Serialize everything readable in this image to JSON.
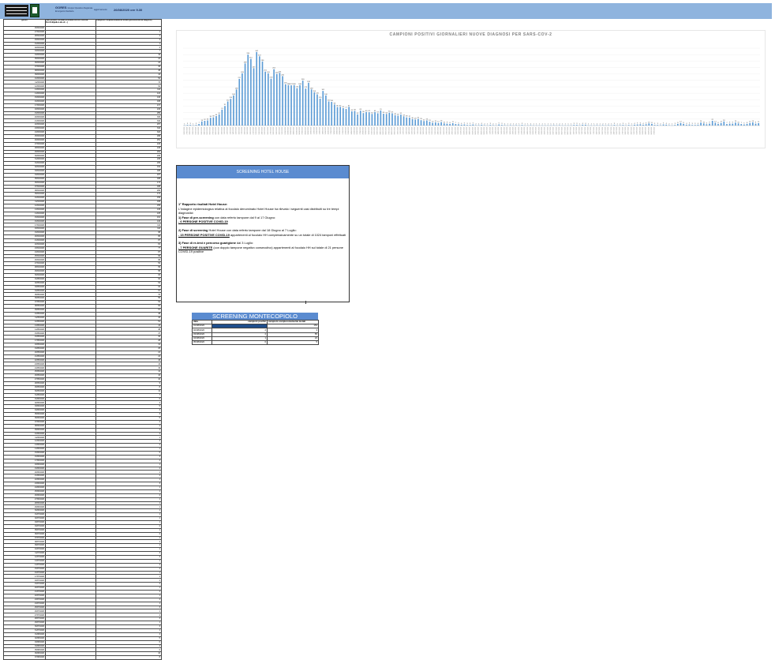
{
  "header": {
    "org": "GORES",
    "org_suffix": "Gruppo Operativo Regionale",
    "org_sub": "Emergenza Sanitaria",
    "updated_label": "aggiornamento",
    "updated_value": "26/08/2020 ore 9.30",
    "logo_icon": "regione-marche-logo",
    "emblem_icon": "gores-emblem"
  },
  "cases_table": {
    "headers": [
      "giorno",
      "Casi positivi Focolaio (Comune HOTEL HOUSE Port.S.Elpidio-Lido di ...)",
      "Campioni complessivamente testati (persona-nuove diagnosi)"
    ],
    "rows": [
      [
        "26/02/2020",
        "",
        ""
      ],
      [
        "27/02/2020",
        "",
        "1"
      ],
      [
        "28/02/2020",
        "",
        "3"
      ],
      [
        "29/02/2020",
        "",
        "3"
      ],
      [
        "01/03/2020",
        "",
        "1"
      ],
      [
        "02/03/2020",
        "",
        "3"
      ],
      [
        "03/03/2020",
        "",
        "7"
      ],
      [
        "04/03/2020",
        "",
        "19"
      ],
      [
        "05/03/2020",
        "",
        "22"
      ],
      [
        "06/03/2020",
        "",
        "24"
      ],
      [
        "07/03/2020",
        "",
        "36"
      ],
      [
        "08/03/2020",
        "",
        "38"
      ],
      [
        "09/03/2020",
        "",
        "44"
      ],
      [
        "10/03/2020",
        "",
        "52"
      ],
      [
        "11/03/2020",
        "",
        "74"
      ],
      [
        "12/03/2020",
        "",
        "91"
      ],
      [
        "13/03/2020",
        "",
        "112"
      ],
      [
        "14/03/2020",
        "",
        "124"
      ],
      [
        "15/03/2020",
        "",
        "140"
      ],
      [
        "16/03/2020",
        "",
        "168"
      ],
      [
        "17/03/2020",
        "",
        "217"
      ],
      [
        "18/03/2020",
        "",
        "243"
      ],
      [
        "19/03/2020",
        "",
        "289"
      ],
      [
        "20/03/2020",
        "",
        "330"
      ],
      [
        "21/03/2020",
        "",
        "310"
      ],
      [
        "22/03/2020",
        "",
        "267"
      ],
      [
        "23/03/2020",
        "",
        "342"
      ],
      [
        "24/03/2020",
        "",
        "322"
      ],
      [
        "25/03/2020",
        "",
        "298"
      ],
      [
        "26/03/2020",
        "",
        "251"
      ],
      [
        "27/03/2020",
        "",
        "243"
      ],
      [
        "28/03/2020",
        "",
        "218"
      ],
      [
        "29/03/2020",
        "",
        "262"
      ],
      [
        "30/03/2020",
        "",
        "240"
      ],
      [
        "31/03/2020",
        "",
        "245"
      ],
      [
        "01/04/2020",
        "",
        "230"
      ],
      [
        "02/04/2020",
        "",
        "192"
      ],
      [
        "03/04/2020",
        "",
        "188"
      ],
      [
        "04/04/2020",
        "",
        "187"
      ],
      [
        "05/04/2020",
        "",
        "188"
      ],
      [
        "06/04/2020",
        "",
        "174"
      ],
      [
        "07/04/2020",
        "",
        "188"
      ],
      [
        "08/04/2020",
        "",
        "209"
      ],
      [
        "09/04/2020",
        "",
        "172"
      ],
      [
        "10/04/2020",
        "",
        "199"
      ],
      [
        "11/04/2020",
        "",
        "168"
      ],
      [
        "12/04/2020",
        "",
        "155"
      ],
      [
        "13/04/2020",
        "",
        "145"
      ],
      [
        "14/04/2020",
        "",
        "125"
      ],
      [
        "15/04/2020",
        "",
        "161"
      ],
      [
        "16/04/2020",
        "",
        "140"
      ],
      [
        "17/04/2020",
        "",
        "112"
      ],
      [
        "18/04/2020",
        "",
        "110"
      ],
      [
        "19/04/2020",
        "",
        "98"
      ],
      [
        "20/04/2020",
        "",
        "86"
      ],
      [
        "21/04/2020",
        "",
        "87"
      ],
      [
        "22/04/2020",
        "",
        "81"
      ],
      [
        "23/04/2020",
        "",
        "77"
      ],
      [
        "24/04/2020",
        "",
        "87"
      ],
      [
        "25/04/2020",
        "",
        "66"
      ],
      [
        "26/04/2020",
        "",
        "68"
      ],
      [
        "27/04/2020",
        "",
        "52"
      ],
      [
        "28/04/2020",
        "",
        "69"
      ],
      [
        "29/04/2020",
        "",
        "58"
      ],
      [
        "30/04/2020",
        "",
        "63"
      ],
      [
        "01/05/2020",
        "",
        "62"
      ],
      [
        "02/05/2020",
        "",
        "54"
      ],
      [
        "03/05/2020",
        "",
        "63"
      ],
      [
        "04/05/2020",
        "",
        "57"
      ],
      [
        "05/05/2020",
        "",
        "70"
      ],
      [
        "06/05/2020",
        "",
        "55"
      ],
      [
        "07/05/2020",
        "",
        "54"
      ],
      [
        "08/05/2020",
        "",
        "60"
      ],
      [
        "09/05/2020",
        "",
        "57"
      ],
      [
        "10/05/2020",
        "",
        "48"
      ],
      [
        "11/05/2020",
        "",
        "46"
      ],
      [
        "12/05/2020",
        "",
        "51"
      ],
      [
        "13/05/2020",
        "",
        "43"
      ],
      [
        "14/05/2020",
        "",
        "38"
      ],
      [
        "15/05/2020",
        "",
        "37"
      ],
      [
        "16/05/2020",
        "",
        "30"
      ],
      [
        "17/05/2020",
        "",
        "28"
      ],
      [
        "18/05/2020",
        "",
        "31"
      ],
      [
        "19/05/2020",
        "",
        "25"
      ],
      [
        "20/05/2020",
        "",
        "21"
      ],
      [
        "21/05/2020",
        "",
        "24"
      ],
      [
        "22/05/2020",
        "",
        "18"
      ],
      [
        "23/05/2020",
        "",
        "13"
      ],
      [
        "24/05/2020",
        "",
        "15"
      ],
      [
        "25/05/2020",
        "",
        "12"
      ],
      [
        "26/05/2020",
        "",
        "16"
      ],
      [
        "27/05/2020",
        "",
        "10"
      ],
      [
        "28/05/2020",
        "",
        "9"
      ],
      [
        "29/05/2020",
        "",
        "8"
      ],
      [
        "30/05/2020",
        "",
        "11"
      ],
      [
        "31/05/2020",
        "",
        "7"
      ],
      [
        "01/06/2020",
        "",
        "6"
      ],
      [
        "02/06/2020",
        "",
        "4"
      ],
      [
        "03/06/2020",
        "",
        "5"
      ],
      [
        "04/06/2020",
        "",
        "3"
      ],
      [
        "05/06/2020",
        "",
        "3"
      ],
      [
        "06/06/2020",
        "",
        "5"
      ],
      [
        "07/06/2020",
        "",
        "2"
      ],
      [
        "08/06/2020",
        "",
        "2"
      ],
      [
        "09/06/2020",
        "",
        "4"
      ],
      [
        "10/06/2020",
        "",
        "2"
      ],
      [
        "11/06/2020",
        "",
        "1"
      ],
      [
        "12/06/2020",
        "",
        "3"
      ],
      [
        "13/06/2020",
        "",
        "2"
      ],
      [
        "14/06/2020",
        "",
        "1"
      ],
      [
        "15/06/2020",
        "",
        "5"
      ],
      [
        "16/06/2020",
        "",
        "3"
      ],
      [
        "17/06/2020",
        "",
        "2"
      ],
      [
        "18/06/2020",
        "",
        "1"
      ],
      [
        "19/06/2020",
        "",
        "2"
      ],
      [
        "20/06/2020",
        "",
        "1"
      ],
      [
        "21/06/2020",
        "",
        "2"
      ],
      [
        "22/06/2020",
        "",
        "1"
      ],
      [
        "23/06/2020",
        "",
        "3"
      ],
      [
        "24/06/2020",
        "",
        "1"
      ],
      [
        "25/06/2020",
        "",
        "1"
      ],
      [
        "26/06/2020",
        "",
        "2"
      ],
      [
        "27/06/2020",
        "",
        "1"
      ],
      [
        "28/06/2020",
        "",
        "1"
      ],
      [
        "29/06/2020",
        "",
        "1"
      ],
      [
        "30/06/2020",
        "",
        "1"
      ],
      [
        "01/07/2020",
        "",
        "1"
      ],
      [
        "02/07/2020",
        "",
        "1"
      ],
      [
        "03/07/2020",
        "",
        "1"
      ],
      [
        "04/07/2020",
        "",
        "2"
      ],
      [
        "05/07/2020",
        "",
        "1"
      ],
      [
        "06/07/2020",
        "",
        "2"
      ],
      [
        "07/07/2020",
        "",
        "1"
      ],
      [
        "08/07/2020",
        "",
        "1"
      ],
      [
        "09/07/2020",
        "",
        "1"
      ],
      [
        "10/07/2020",
        "",
        "1"
      ],
      [
        "11/07/2020",
        "",
        "3"
      ],
      [
        "12/07/2020",
        "",
        "3"
      ],
      [
        "13/07/2020",
        "",
        "1"
      ],
      [
        "14/07/2020",
        "",
        "4"
      ],
      [
        "15/07/2020",
        "",
        "4"
      ],
      [
        "16/07/2020",
        "",
        "1"
      ],
      [
        "17/07/2020",
        "",
        "1"
      ],
      [
        "18/07/2020",
        "",
        "1"
      ],
      [
        "19/07/2020",
        "",
        "2"
      ],
      [
        "20/07/2020",
        "",
        "1"
      ],
      [
        "21/07/2020",
        "",
        "2"
      ],
      [
        "22/07/2020",
        "",
        "1"
      ],
      [
        "23/07/2020",
        "",
        "2"
      ],
      [
        "24/07/2020",
        "",
        "1"
      ],
      [
        "25/07/2020",
        "",
        "3"
      ],
      [
        "26/07/2020",
        "",
        "1"
      ],
      [
        "27/07/2020",
        "",
        "2"
      ],
      [
        "28/07/2020",
        "",
        "3"
      ],
      [
        "29/07/2020",
        "",
        "1"
      ],
      [
        "30/07/2020",
        "",
        "3"
      ],
      [
        "31/07/2020",
        "",
        "1"
      ],
      [
        "01/08/2020",
        "",
        "4"
      ],
      [
        "02/08/2020",
        "",
        "5"
      ],
      [
        "03/08/2020",
        "",
        "6"
      ],
      [
        "04/08/2020",
        "",
        "4"
      ],
      [
        "05/08/2020",
        "",
        "6"
      ],
      [
        "06/08/2020",
        "",
        "10"
      ],
      [
        "07/08/2020",
        "",
        "8"
      ]
    ]
  },
  "chart_data": {
    "type": "bar",
    "title": "CAMPIONI POSITIVI GIORNALIERI NUOVE DIAGNOSI PER SARS-COV-2",
    "xlabel": "",
    "ylabel": "",
    "ylim": [
      0,
      360
    ],
    "grid": true,
    "bar_color": "#5b9bd5",
    "x_start_label": "26/02/2020",
    "values": [
      1,
      3,
      3,
      1,
      3,
      7,
      19,
      22,
      24,
      36,
      38,
      44,
      52,
      74,
      91,
      112,
      124,
      140,
      168,
      217,
      243,
      289,
      330,
      310,
      267,
      342,
      322,
      298,
      251,
      243,
      218,
      262,
      240,
      245,
      230,
      192,
      188,
      187,
      188,
      174,
      188,
      209,
      172,
      199,
      168,
      155,
      145,
      125,
      161,
      140,
      112,
      110,
      98,
      86,
      87,
      81,
      77,
      87,
      66,
      68,
      52,
      69,
      58,
      63,
      62,
      54,
      63,
      57,
      70,
      55,
      54,
      60,
      57,
      48,
      46,
      51,
      43,
      38,
      37,
      30,
      28,
      31,
      25,
      21,
      24,
      18,
      13,
      15,
      12,
      16,
      10,
      9,
      8,
      11,
      7,
      6,
      4,
      5,
      3,
      3,
      5,
      2,
      2,
      4,
      2,
      1,
      3,
      2,
      1,
      5,
      3,
      2,
      1,
      2,
      1,
      2,
      1,
      3,
      1,
      1,
      2,
      1,
      1,
      1,
      1,
      1,
      1,
      1,
      2,
      1,
      2,
      1,
      1,
      1,
      1,
      3,
      3,
      1,
      4,
      4,
      1,
      1,
      1,
      2,
      1,
      2,
      1,
      2,
      1,
      3,
      1,
      2,
      3,
      1,
      3,
      1,
      4,
      5,
      6,
      4,
      6,
      10,
      8,
      3,
      3,
      2,
      5,
      4,
      2,
      1,
      3,
      8,
      12,
      8,
      4,
      5,
      3,
      3,
      4,
      14,
      10,
      6,
      9,
      22,
      13,
      8,
      12,
      19,
      7,
      9,
      9,
      14,
      10,
      7,
      5,
      8,
      12,
      15,
      9,
      11
    ]
  },
  "hotel_house": {
    "title": "SCREENING HOTEL HOUSE",
    "heading": "1° Rapporto risultati Hotel House:",
    "intro": "L'indagine epidemiologica relativa al focolaio denominato Hotel House ha rilevato i seguenti casi distribuiti su tre tempi diagnostici:",
    "phase1_label": "1) Fase di pre-screening",
    "phase1_text": " con data referto tampone dal 9 al 17 Giugno:",
    "phase1_result": "- 6 PERSONE POSITIVE COVID-19",
    "phase2_label": "2) Fase di screening",
    "phase2_text": " Hotel House con data referto tampone dal 18 Giugno al 7 Luglio:",
    "phase2_result_strong": "- 15 PERSONE POSITIVE COVID-19",
    "phase2_result_rest": " appartenenti al focolaio HH complessivamente su un totale di 1024 tamponi effettuati",
    "phase3_label": "3) Fase di re-test e percorso guarigione",
    "phase3_text": " dal 3 Luglio:",
    "phase3_result_strong": "- 7 PERSONE GUARITE",
    "phase3_result_rest": " (con doppio tampone negativo consecutivo) appartenenti al focolaio HH sul totale di 21 persone COVID-19 positive"
  },
  "montecopiolo": {
    "title": "SCREENING MONTECOPIOLO",
    "headers": [
      "data",
      "campioni positivi",
      "campioni complessivamente testati"
    ],
    "rows": [
      [
        "01/08/2020",
        "",
        "153"
      ],
      [
        "02/08/2020",
        "2",
        "3"
      ],
      [
        "03/08/2020",
        "2",
        "65"
      ],
      [
        "04/08/2020",
        "1",
        "24"
      ],
      [
        "05/08/2020",
        "0",
        "5"
      ]
    ],
    "highlight_color": "#1f4e8c"
  }
}
